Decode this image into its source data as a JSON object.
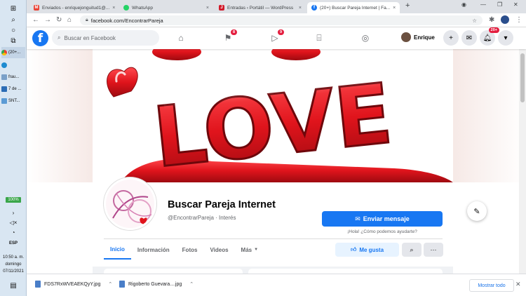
{
  "taskbar": {
    "apps": [
      "(20+...",
      "frau...",
      "7 de ...",
      "SNT..."
    ],
    "battery": "100%",
    "lang": "ESP",
    "time": "10:50 a. m.",
    "day": "domingo",
    "date": "07/11/2021"
  },
  "browser": {
    "tabs": [
      {
        "title": "Enviados - enriquejonguitud1@..."
      },
      {
        "title": "WhatsApp"
      },
      {
        "title": "Entradas ‹ Portátil — WordPress"
      },
      {
        "title": "(20+) Buscar Pareja Internet | Fa..."
      }
    ],
    "url": "facebook.com/EncontrarPareja"
  },
  "fb": {
    "logo": "f",
    "search_placeholder": "Buscar en Facebook",
    "pages_badge": "8",
    "watch_badge": "9",
    "notif_badge": "20+",
    "user_name": "Enrique"
  },
  "page": {
    "name": "Buscar Pareja Internet",
    "handle": "@EncontrarPareja · Interés",
    "message_button": "Enviar mensaje",
    "message_hint": "¡Hola! ¿Cómo podemos ayudarte?",
    "tabs": [
      "Inicio",
      "Información",
      "Fotos",
      "Videos",
      "Más"
    ],
    "like_button": "Me gusta",
    "cover_text": "LOVE"
  },
  "downloads": {
    "files": [
      "FDS7RxWVEAEKQyY.jpg",
      "Rigoberto Guevara....jpg"
    ],
    "show_all": "Mostrar todo"
  },
  "colors": {
    "fb_blue": "#1877f2",
    "love_red": "#e0141c",
    "badge_red": "#e41e3f"
  }
}
